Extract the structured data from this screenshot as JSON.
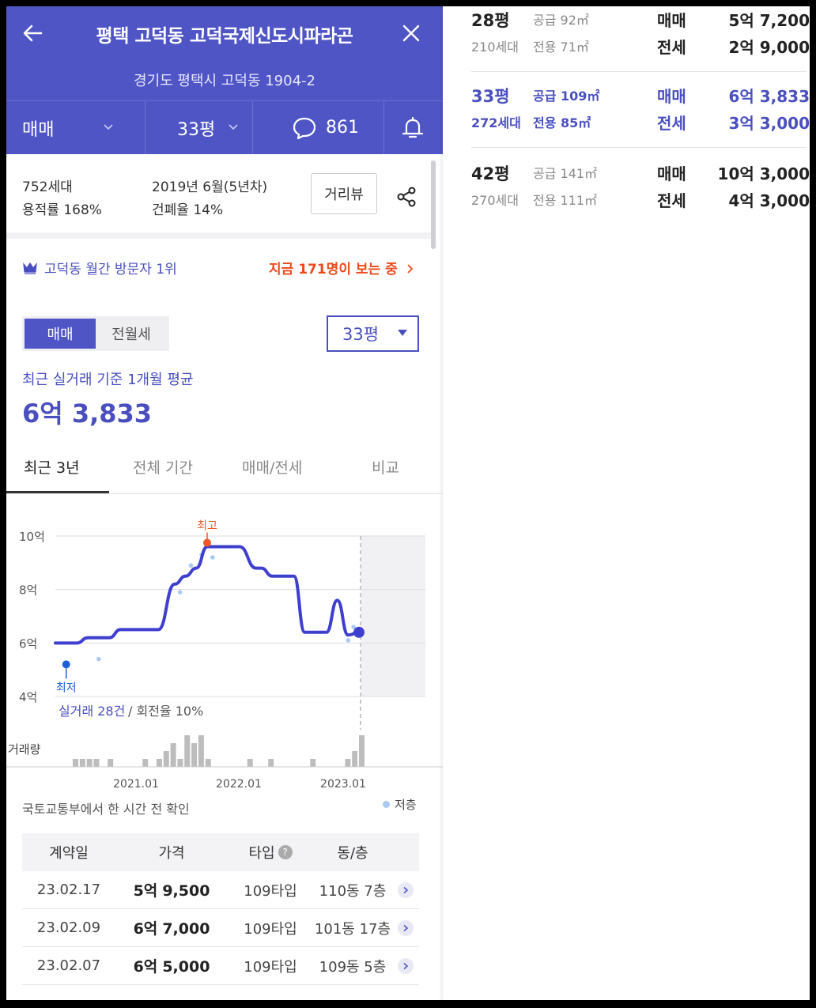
{
  "header": {
    "title": "평택 고덕동 고덕국제신도시파라곤",
    "address": "경기도 평택시 고덕동 1904-2",
    "tabs": {
      "trade": "매매",
      "size": "33평",
      "comments": "861"
    }
  },
  "stats": {
    "households": "752세대",
    "far": "용적률 168%",
    "built": "2019년 6월(5년차)",
    "bcr": "건폐율 14%",
    "street_view": "거리뷰"
  },
  "visitor": {
    "rank": "고덕동 월간 방문자 1위",
    "viewing": "지금 171명이 보는 중"
  },
  "toggle": {
    "on": "매매",
    "off": "전월세"
  },
  "size_select": "33평",
  "average": {
    "label": "최근 실거래 기준 1개월 평균",
    "price": "6억 3,833"
  },
  "period_tabs": [
    "최근 3년",
    "전체 기간",
    "매매/전세",
    "비교"
  ],
  "chart_data": {
    "type": "line",
    "y_ticks": [
      "10억",
      "8억",
      "6억",
      "4억"
    ],
    "ylim": [
      4,
      10
    ],
    "x_ticks": [
      "2021.01",
      "2022.01",
      "2023.01"
    ],
    "series": [],
    "trend": [
      [
        0,
        6.0
      ],
      [
        4,
        6.0
      ],
      [
        6,
        6.2
      ],
      [
        10,
        6.2
      ],
      [
        12,
        6.5
      ],
      [
        19,
        6.5
      ],
      [
        22,
        8.2
      ],
      [
        24,
        8.5
      ],
      [
        26,
        8.8
      ],
      [
        28,
        9.6
      ],
      [
        34,
        9.6
      ],
      [
        37,
        8.8
      ],
      [
        38,
        8.8
      ],
      [
        40,
        8.5
      ],
      [
        44,
        8.5
      ],
      [
        46,
        6.4
      ],
      [
        50,
        6.4
      ],
      [
        52,
        7.6
      ],
      [
        54,
        6.3
      ],
      [
        56,
        6.4
      ]
    ],
    "trade_points": [
      [
        2,
        5.2
      ],
      [
        8,
        5.4
      ],
      [
        23,
        7.9
      ],
      [
        25,
        8.9
      ],
      [
        27,
        9.3
      ],
      [
        29,
        9.2
      ],
      [
        54,
        6.1
      ],
      [
        55,
        6.6
      ]
    ],
    "volume": [
      1,
      1,
      1,
      1,
      0,
      1,
      0,
      0,
      0,
      0,
      1,
      0,
      1,
      2,
      3,
      1,
      4,
      3,
      4,
      1,
      0,
      0,
      0,
      0,
      0,
      1,
      0,
      0,
      1,
      0,
      0,
      0,
      0,
      0,
      1,
      0,
      0,
      0,
      0,
      1,
      2,
      4
    ],
    "high_label": "최고",
    "low_label": "최저",
    "volume_label": "거래량",
    "summary_count": "실거래 28건",
    "summary_rate": "/ 회전율 10%",
    "colors": {
      "line": "#3f3fcf",
      "high": "#ec5a2a",
      "low": "#1f5fd8",
      "point": "#a9c9f2",
      "bar": "#bdbdbd"
    }
  },
  "chart_note": "국토교통부에서 한 시간 전 확인",
  "legend_low": "저층",
  "table": {
    "headers": [
      "계약일",
      "가격",
      "타입",
      "동/층"
    ],
    "help": "?",
    "rows": [
      {
        "date": "23.02.17",
        "price_a": "5억",
        "price_b": "9,500",
        "type": "109타입",
        "unit": "110동 7층"
      },
      {
        "date": "23.02.09",
        "price_a": "6억",
        "price_b": "7,000",
        "type": "109타입",
        "unit": "101동 17층"
      },
      {
        "date": "23.02.07",
        "price_a": "6억",
        "price_b": "5,000",
        "type": "109타입",
        "unit": "109동 5층"
      }
    ]
  },
  "units": [
    {
      "py": "28평",
      "hh": "210세대",
      "sup": "공급 92㎡",
      "exc": "전용 71㎡",
      "t1": "매매",
      "p1": "5억 7,200",
      "t2": "전세",
      "p2": "2억 9,000",
      "selected": false
    },
    {
      "py": "33평",
      "hh": "272세대",
      "sup": "공급 109㎡",
      "exc": "전용 85㎡",
      "t1": "매매",
      "p1": "6억 3,833",
      "t2": "전세",
      "p2": "3억 3,000",
      "selected": true
    },
    {
      "py": "42평",
      "hh": "270세대",
      "sup": "공급 141㎡",
      "exc": "전용 111㎡",
      "t1": "매매",
      "p1": "10억 3,000",
      "t2": "전세",
      "p2": "4억 3,000",
      "selected": false
    }
  ]
}
